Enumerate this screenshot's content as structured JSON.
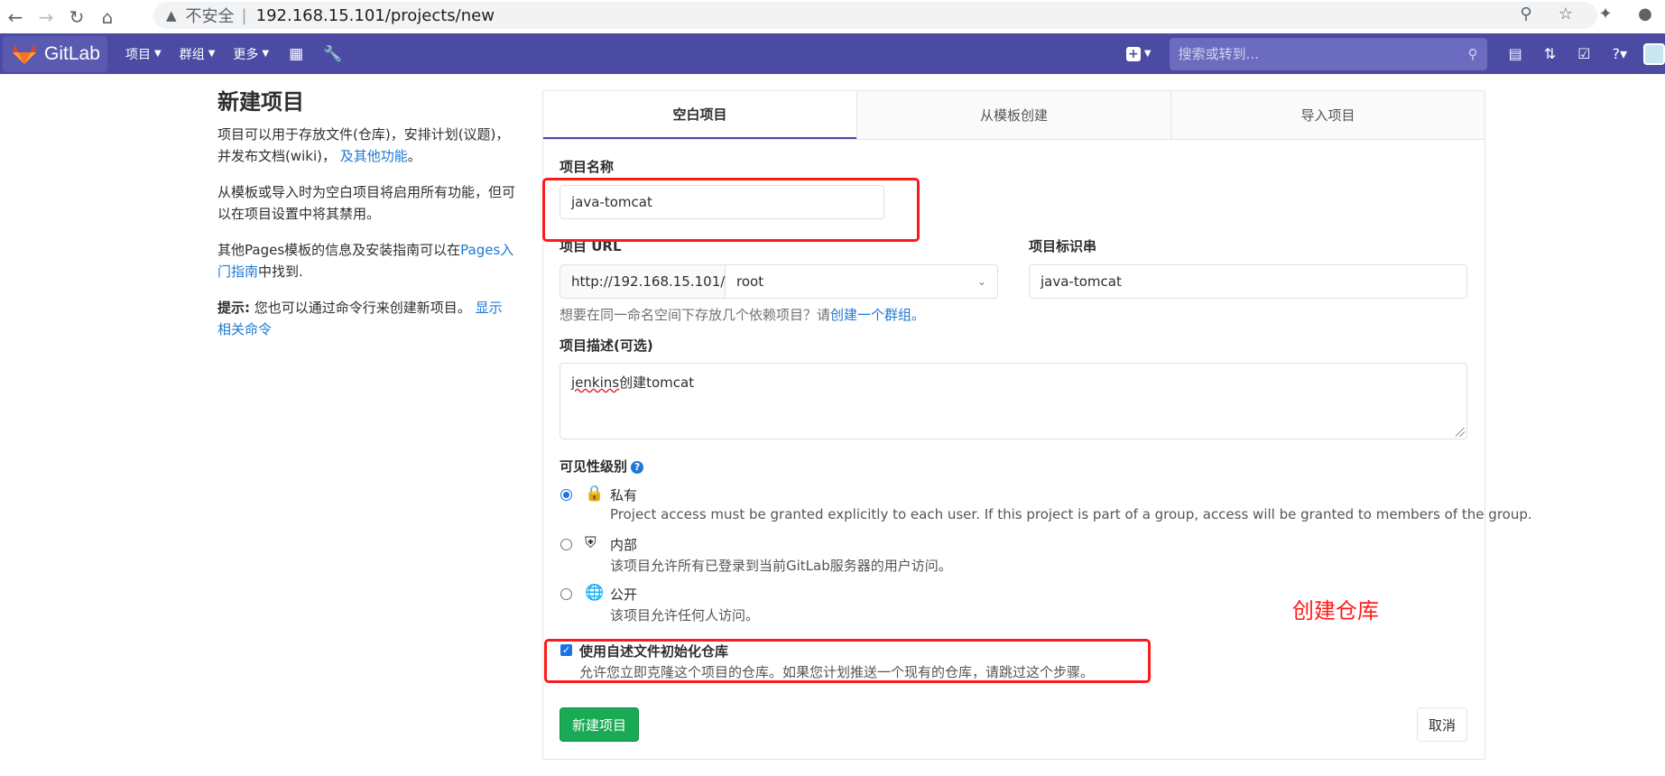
{
  "browser": {
    "insecure_label": "不安全",
    "separator": "|",
    "url": "192.168.15.101/projects/new"
  },
  "navbar": {
    "brand": "GitLab",
    "items": [
      {
        "label": "项目"
      },
      {
        "label": "群组"
      },
      {
        "label": "更多"
      }
    ],
    "search_placeholder": "搜索或转到..."
  },
  "intro": {
    "title": "新建项目",
    "p1": "项目可以用于存放文件(仓库)，安排计划(议题)，并发布文档(wiki)，",
    "p1_link": "及其他功能",
    "p1_end": "。",
    "p2": "从模板或导入时为空白项目将启用所有功能，但可以在项目设置中将其禁用。",
    "p3_start": "其他Pages模板的信息及安装指南可以在",
    "p3_link": "Pages入门指南",
    "p3_end": "中找到.",
    "tip_label": "提示:",
    "tip_text": "您也可以通过命令行来创建新项目。",
    "tip_link": "显示相关命令"
  },
  "tabs": [
    {
      "label": "空白项目",
      "active": true
    },
    {
      "label": "从模板创建",
      "active": false
    },
    {
      "label": "导入项目",
      "active": false
    }
  ],
  "form": {
    "name_label": "项目名称",
    "name_value": "java-tomcat",
    "url_label": "项目 URL",
    "url_prefix": "http://192.168.15.101/",
    "namespace": "root",
    "slug_label": "项目标识串",
    "slug_value": "java-tomcat",
    "help_text": "想要在同一命名空间下存放几个依赖项目？请",
    "help_link": "创建一个群组。",
    "desc_label": "项目描述(可选)",
    "desc_value_misspelled": "jenkins",
    "desc_value_rest": "创建tomcat",
    "visibility_label": "可见性级别",
    "visibility": [
      {
        "title": "私有",
        "desc": "Project access must be granted explicitly to each user. If this project is part of a group, access will be granted to members of the group.",
        "icon": "lock-icon",
        "checked": true
      },
      {
        "title": "内部",
        "desc": "该项目允许所有已登录到当前GitLab服务器的用户访问。",
        "icon": "shield-icon",
        "checked": false
      },
      {
        "title": "公开",
        "desc": "该项目允许任何人访问。",
        "icon": "globe-icon",
        "checked": false
      }
    ],
    "readme_label": "使用自述文件初始化仓库",
    "readme_desc": "允许您立即克隆这个项目的仓库。如果您计划推送一个现有的仓库，请跳过这个步骤。",
    "readme_checked": true,
    "submit_label": "新建项目",
    "cancel_label": "取消"
  },
  "annotation": {
    "text": "创建仓库",
    "color": "#ff1a1a"
  },
  "colors": {
    "navbar": "#4b4ba3",
    "primary_button": "#1aaa55",
    "link": "#1f78d1"
  }
}
